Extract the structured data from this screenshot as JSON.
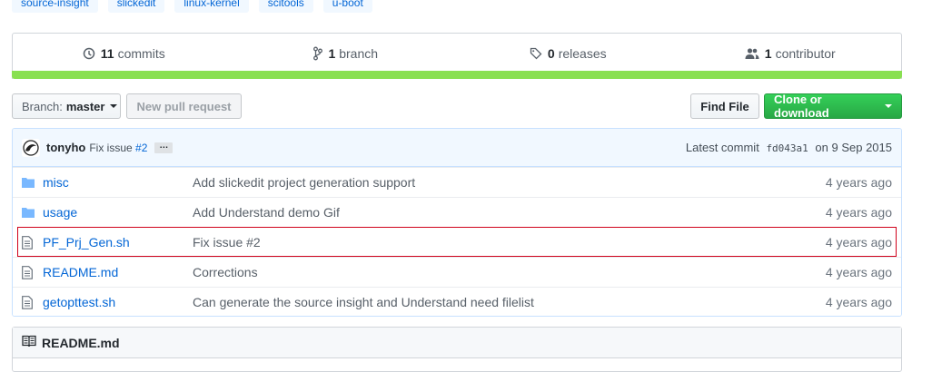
{
  "topics": [
    "source-insight",
    "slickedit",
    "linux-kernel",
    "scitools",
    "u-boot"
  ],
  "summary": {
    "commits": {
      "count": "11",
      "label": "commits"
    },
    "branches": {
      "count": "1",
      "label": "branch"
    },
    "releases": {
      "count": "0",
      "label": "releases"
    },
    "contributors": {
      "count": "1",
      "label": "contributor"
    }
  },
  "colors": {
    "language_bar": "#89e051",
    "accent": "#0366d6",
    "clone": "#28a745",
    "highlight": "#d0021b"
  },
  "nav": {
    "branch_label": "Branch:",
    "branch_value": "master",
    "new_pr": "New pull request",
    "find_file": "Find File",
    "clone": "Clone or download"
  },
  "commit": {
    "author": "tonyho",
    "message": "Fix issue",
    "issue": "#2",
    "ellipsis": "…",
    "latest_label": "Latest commit",
    "sha": "fd043a1",
    "date": "on 9 Sep 2015"
  },
  "files": [
    {
      "type": "folder",
      "name": "misc",
      "message": "Add slickedit project generation support",
      "age": "4 years ago"
    },
    {
      "type": "folder",
      "name": "usage",
      "message": "Add Understand demo Gif",
      "age": "4 years ago"
    },
    {
      "type": "file",
      "name": "PF_Prj_Gen.sh",
      "message": "Fix issue #2",
      "age": "4 years ago"
    },
    {
      "type": "file",
      "name": "README.md",
      "message": "Corrections",
      "age": "4 years ago"
    },
    {
      "type": "file",
      "name": "getopttest.sh",
      "message": "Can generate the source insight and Understand need filelist",
      "age": "4 years ago"
    }
  ],
  "readme": {
    "title": "README.md"
  }
}
